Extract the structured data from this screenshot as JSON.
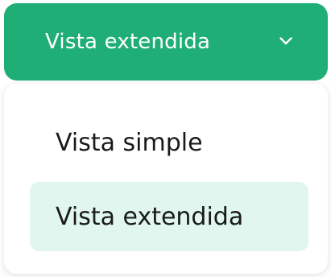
{
  "dropdown": {
    "selected_label": "Vista extendida",
    "icon": "chevron-down-icon",
    "accent_color": "#1faf76"
  },
  "menu": {
    "items": [
      {
        "label": "Vista simple",
        "selected": false
      },
      {
        "label": "Vista extendida",
        "selected": true
      }
    ],
    "selected_bg_color": "#e0f6ef"
  }
}
